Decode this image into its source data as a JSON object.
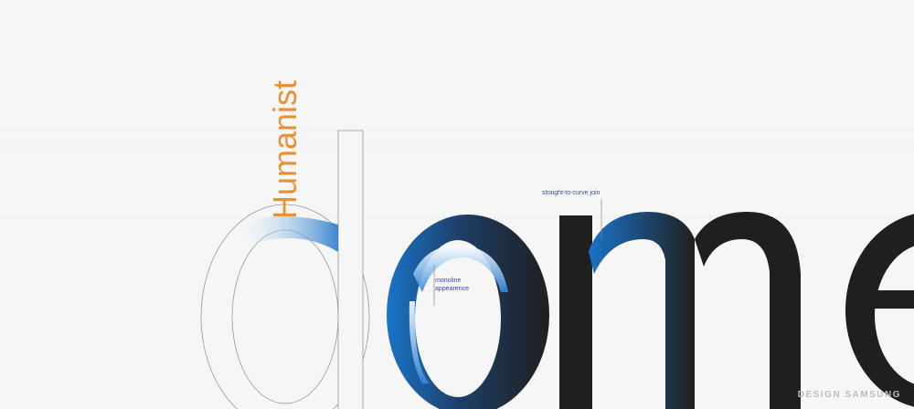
{
  "vertical_label": "Humanist",
  "word": "dome",
  "annotations": {
    "join": "straight-to-curve join",
    "monoline_line1": "monoline",
    "monoline_line2": "appearence"
  },
  "brand": "DESIGN SAMSUNG",
  "colors": {
    "background": "#f6f6f6",
    "ink": "#1f1f1f",
    "accent_blue": "#1a73c9",
    "label_orange": "#e8912e",
    "annotation_blue": "#3a4aa8",
    "guide_gray": "#dcdcdc"
  }
}
